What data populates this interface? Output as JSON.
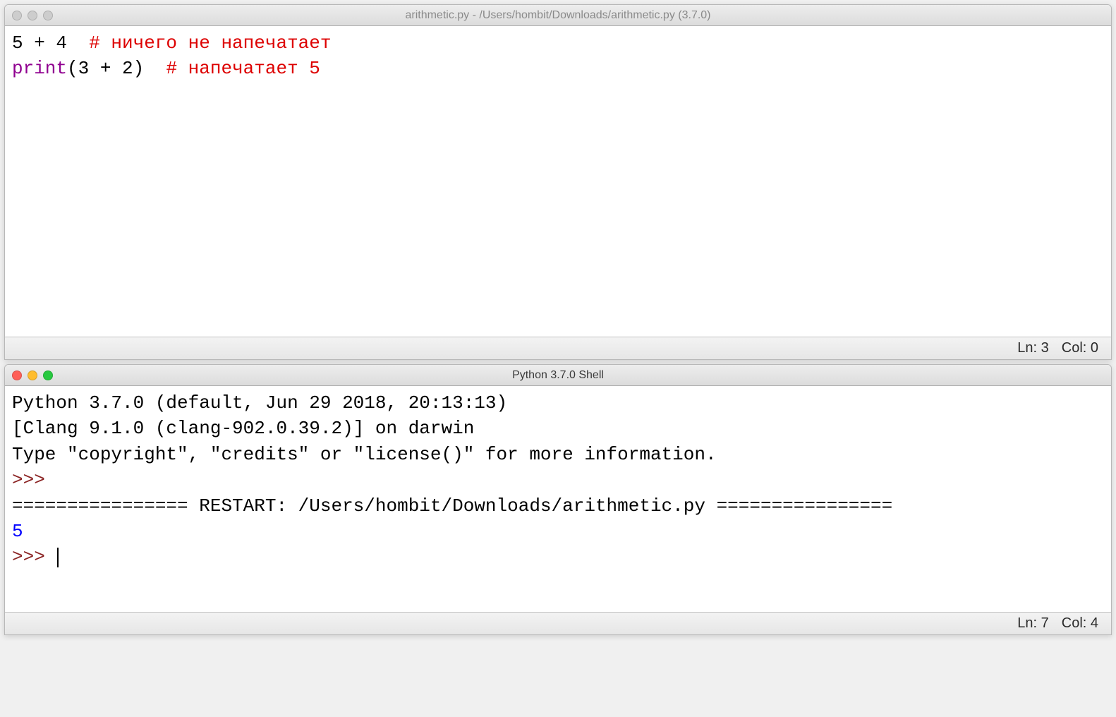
{
  "editor_window": {
    "title": "arithmetic.py - /Users/hombit/Downloads/arithmetic.py (3.7.0)",
    "code": {
      "line1_expr": "5 + 4  ",
      "line1_comment": "# ничего не напечатает",
      "line2_builtin": "print",
      "line2_rest": "(3 + 2)  ",
      "line2_comment": "# напечатает 5"
    },
    "status": {
      "ln_label": "Ln: 3",
      "col_label": "Col: 0"
    }
  },
  "shell_window": {
    "title": "Python 3.7.0 Shell",
    "banner_line1": "Python 3.7.0 (default, Jun 29 2018, 20:13:13) ",
    "banner_line2": "[Clang 9.1.0 (clang-902.0.39.2)] on darwin",
    "banner_line3": "Type \"copyright\", \"credits\" or \"license()\" for more information.",
    "prompt1": ">>> ",
    "restart_line": "================ RESTART: /Users/hombit/Downloads/arithmetic.py ================",
    "output": "5",
    "prompt2": ">>> ",
    "status": {
      "ln_label": "Ln: 7",
      "col_label": "Col: 4"
    }
  }
}
